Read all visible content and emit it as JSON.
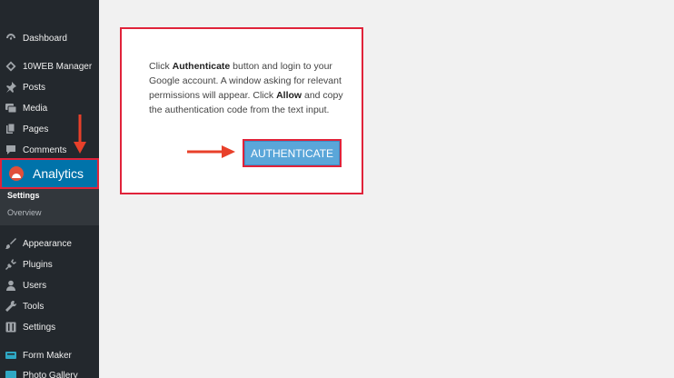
{
  "sidebar": {
    "items": [
      {
        "label": "Dashboard",
        "icon": "dashboard-icon"
      },
      {
        "label": "10WEB Manager",
        "icon": "diamond-icon"
      },
      {
        "label": "Posts",
        "icon": "pin-icon"
      },
      {
        "label": "Media",
        "icon": "media-icon"
      },
      {
        "label": "Pages",
        "icon": "pages-icon"
      },
      {
        "label": "Comments",
        "icon": "comment-icon"
      },
      {
        "label": "Appearance",
        "icon": "brush-icon"
      },
      {
        "label": "Plugins",
        "icon": "plug-icon"
      },
      {
        "label": "Users",
        "icon": "user-icon"
      },
      {
        "label": "Tools",
        "icon": "wrench-icon"
      },
      {
        "label": "Settings",
        "icon": "settings-icon"
      },
      {
        "label": "Form Maker",
        "icon": "form-icon"
      },
      {
        "label": "Photo Gallery",
        "icon": "gallery-icon"
      }
    ],
    "active": {
      "label": "Analytics",
      "icon": "analytics-logo-icon"
    },
    "submenu": [
      {
        "label": "Settings",
        "active": true
      },
      {
        "label": "Overview",
        "active": false
      }
    ]
  },
  "dialog": {
    "text_1": "Click ",
    "bold_1": "Authenticate",
    "text_2": " button and login to your Google account. A window asking for relevant permissions will appear. Click ",
    "bold_2": "Allow",
    "text_3": " and copy the authentication code from the text input.",
    "button_label": "AUTHENTICATE"
  },
  "colors": {
    "sidebar_bg": "#23282d",
    "active_bg": "#0073aa",
    "highlight": "#e0233a",
    "button_bg": "#5aa6d9",
    "arrow": "#e8402a"
  }
}
